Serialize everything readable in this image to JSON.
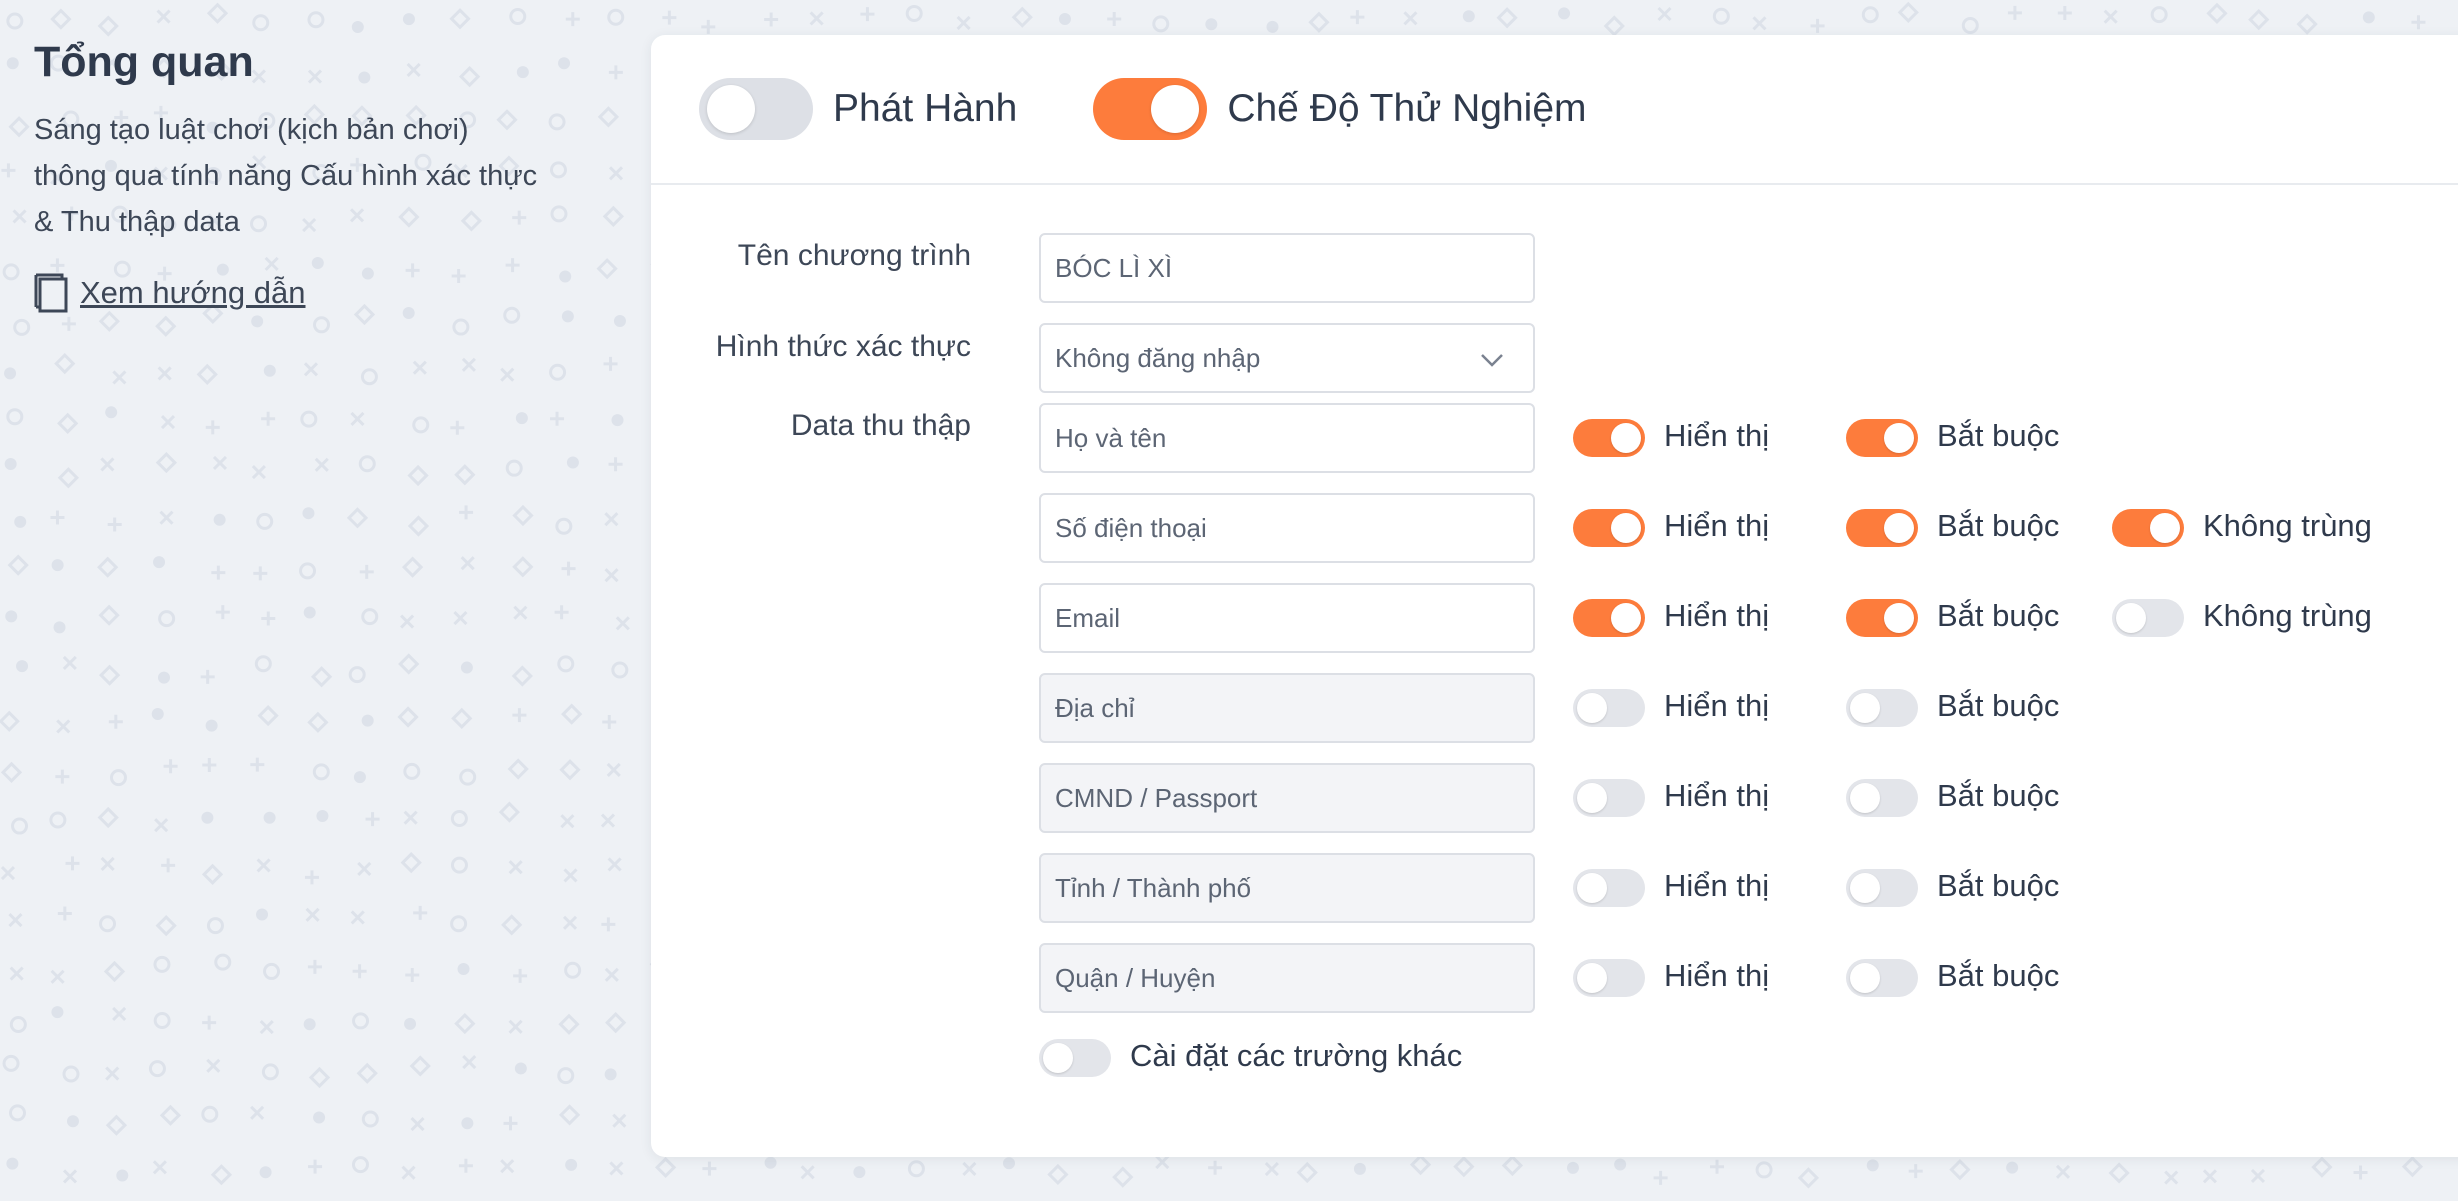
{
  "overview": {
    "title": "Tổng quan",
    "description_lines": [
      "Sáng tạo luật chơi (kịch bản chơi)",
      "thông qua tính năng Cấu hình xác thực",
      "& Thu thập data"
    ],
    "guide_link": "Xem hướng dẫn"
  },
  "header": {
    "publish": {
      "label": "Phát Hành",
      "on": false
    },
    "test_mode": {
      "label": "Chế Độ Thử Nghiệm",
      "on": true
    }
  },
  "form": {
    "program_name_label": "Tên chương trình",
    "program_name_value": "BÓC LÌ XÌ",
    "auth_label": "Hình thức xác thực",
    "auth_value": "Không đăng nhập",
    "data_label": "Data thu thập",
    "show_label": "Hiển thị",
    "required_label": "Bắt buộc",
    "unique_label": "Không trùng",
    "fields": [
      {
        "name": "Họ và tên",
        "show": true,
        "required": true,
        "unique": null,
        "disabled": false
      },
      {
        "name": "Số điện thoại",
        "show": true,
        "required": true,
        "unique": true,
        "disabled": false
      },
      {
        "name": "Email",
        "show": true,
        "required": true,
        "unique": false,
        "disabled": false
      },
      {
        "name": "Địa chỉ",
        "show": false,
        "required": false,
        "unique": null,
        "disabled": true
      },
      {
        "name": "CMND / Passport",
        "show": false,
        "required": false,
        "unique": null,
        "disabled": true
      },
      {
        "name": "Tỉnh / Thành phố",
        "show": false,
        "required": false,
        "unique": null,
        "disabled": true
      },
      {
        "name": "Quận / Huyện",
        "show": false,
        "required": false,
        "unique": null,
        "disabled": true
      }
    ],
    "other_fields": {
      "label": "Cài đặt các trường khác",
      "on": false
    }
  },
  "colors": {
    "accent": "#fd7c3c",
    "toggle_off": "#e3e5ea"
  }
}
